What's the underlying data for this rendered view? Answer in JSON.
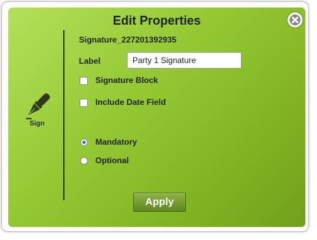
{
  "dialog": {
    "title": "Edit Properties",
    "close_icon": "close-icon"
  },
  "sidebar": {
    "icon": "pen-icon",
    "label": "Sign"
  },
  "form": {
    "signature_name": "Signature_227201392935",
    "label_caption": "Label",
    "label_value": "Party 1 Signature",
    "signature_block": {
      "label": "Signature Block",
      "checked": false
    },
    "include_date": {
      "label": "Include Date Field",
      "checked": false
    },
    "requirement": {
      "options": [
        "Mandatory",
        "Optional"
      ],
      "selected": "Mandatory"
    }
  },
  "actions": {
    "apply_label": "Apply"
  },
  "colors": {
    "panel_light": "#b3e05a",
    "panel_dark": "#6fa11b",
    "radio_selected": "#3a6fc4"
  }
}
